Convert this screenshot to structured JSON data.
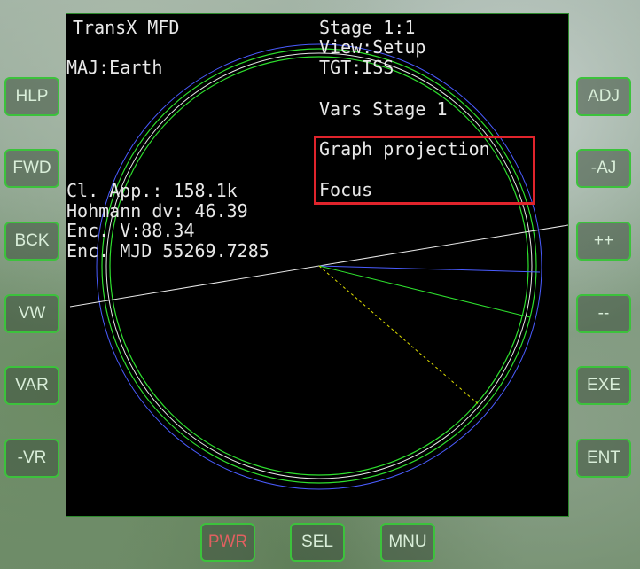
{
  "mfd": {
    "title": "TransX MFD",
    "stage": "Stage 1:1",
    "view": "View:Setup",
    "major": "MAJ:Earth",
    "target": "TGT:ISS",
    "vars_stage": "Vars Stage 1",
    "options": [
      "Graph projection",
      "Focus"
    ],
    "closest_approach": "Cl. App.: 158.1k",
    "hohmann_dv": "Hohmann dv: 46.39",
    "enc_v": "Enc. V:88.34",
    "enc_mjd": "Enc. MJD 55269.7285"
  },
  "left_buttons": [
    "HLP",
    "FWD",
    "BCK",
    "VW",
    "VAR",
    "-VR"
  ],
  "right_buttons": [
    "ADJ",
    "-AJ",
    "++",
    "--",
    "EXE",
    "ENT"
  ],
  "bottom_buttons": [
    "PWR",
    "SEL",
    "MNU"
  ],
  "colors": {
    "button_border": "#3cc23c",
    "highlight": "#e0242c",
    "orbit_green": "#2ee02e",
    "orbit_blue": "#4a5cff",
    "text": "#e8e8e8"
  }
}
